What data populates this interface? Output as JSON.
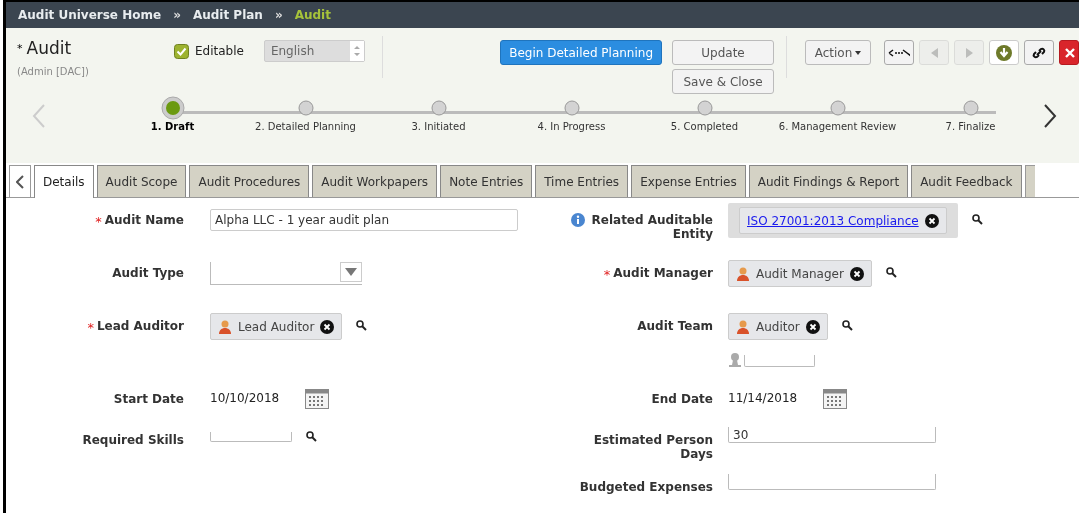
{
  "breadcrumb": [
    {
      "label": "Audit Universe Home",
      "current": false
    },
    {
      "label": "Audit Plan",
      "current": false
    },
    {
      "label": "Audit",
      "current": true
    }
  ],
  "breadcrumb_separator": "»",
  "required_mark": "*",
  "record": {
    "title": "Audit",
    "required": true,
    "subtitle": "(Admin [DAC])"
  },
  "editable": {
    "label": "Editable",
    "checked": true
  },
  "language": {
    "value": "English"
  },
  "buttons": [
    {
      "label": "Begin Detailed Planning",
      "kind": "primary"
    },
    {
      "label": "Update",
      "kind": "plain"
    },
    {
      "label": "Save & Close",
      "kind": "plain"
    },
    {
      "label": "Action",
      "kind": "menu"
    }
  ],
  "icon_buttons": [
    {
      "kind": "expand",
      "disabled": false
    },
    {
      "kind": "previous",
      "disabled": true
    },
    {
      "kind": "next",
      "disabled": true
    },
    {
      "kind": "download",
      "disabled": false
    },
    {
      "kind": "link",
      "disabled": false
    },
    {
      "kind": "close",
      "disabled": false
    }
  ],
  "steps": [
    {
      "label": "1. Draft",
      "selected": true
    },
    {
      "label": "2. Detailed Planning",
      "selected": false
    },
    {
      "label": "3. Initiated",
      "selected": false
    },
    {
      "label": "4. In Progress",
      "selected": false
    },
    {
      "label": "5. Completed",
      "selected": false
    },
    {
      "label": "6. Management Review",
      "selected": false
    },
    {
      "label": "7. Finalize",
      "selected": false
    }
  ],
  "tabs": [
    {
      "label": "Details",
      "selected": true
    },
    {
      "label": "Audit Scope",
      "selected": false
    },
    {
      "label": "Audit Procedures",
      "selected": false
    },
    {
      "label": "Audit Workpapers",
      "selected": false
    },
    {
      "label": "Note Entries",
      "selected": false
    },
    {
      "label": "Time Entries",
      "selected": false
    },
    {
      "label": "Expense Entries",
      "selected": false
    },
    {
      "label": "Audit Findings & Report",
      "selected": false
    },
    {
      "label": "Audit Feedback",
      "selected": false
    }
  ],
  "form": [
    {
      "left": {
        "label": "Audit Name",
        "kind": "text",
        "required": true,
        "value": "Alpha LLC - 1 year audit plan"
      },
      "right": {
        "label": "Related Auditable Entity",
        "kind": "link_chips",
        "info": true,
        "chips": [
          "ISO 27001:2013 Compliance"
        ]
      }
    },
    {
      "left": {
        "label": "Audit Type",
        "kind": "dropdown"
      },
      "right": {
        "label": "Audit Manager",
        "kind": "user_chips",
        "required": true,
        "chips": [
          "Audit Manager"
        ]
      }
    },
    {
      "left": {
        "label": "Lead Auditor",
        "kind": "user_chips",
        "required": true,
        "chips": [
          "Lead Auditor"
        ]
      },
      "right": {
        "label": "Audit Team",
        "kind": "user_chips",
        "add_user": true,
        "chips": [
          "Auditor"
        ]
      }
    },
    {
      "left": {
        "label": "Start Date",
        "kind": "date",
        "value": "10/10/2018"
      },
      "right": {
        "label": "End Date",
        "kind": "date",
        "value": "11/14/2018"
      }
    },
    {
      "left": {
        "label": "Required Skills",
        "kind": "lookup"
      },
      "right": {
        "label": "Estimated Person Days",
        "kind": "underline",
        "value": "30"
      }
    },
    {
      "right": {
        "label": "Budgeted Expenses",
        "kind": "underline"
      }
    }
  ]
}
